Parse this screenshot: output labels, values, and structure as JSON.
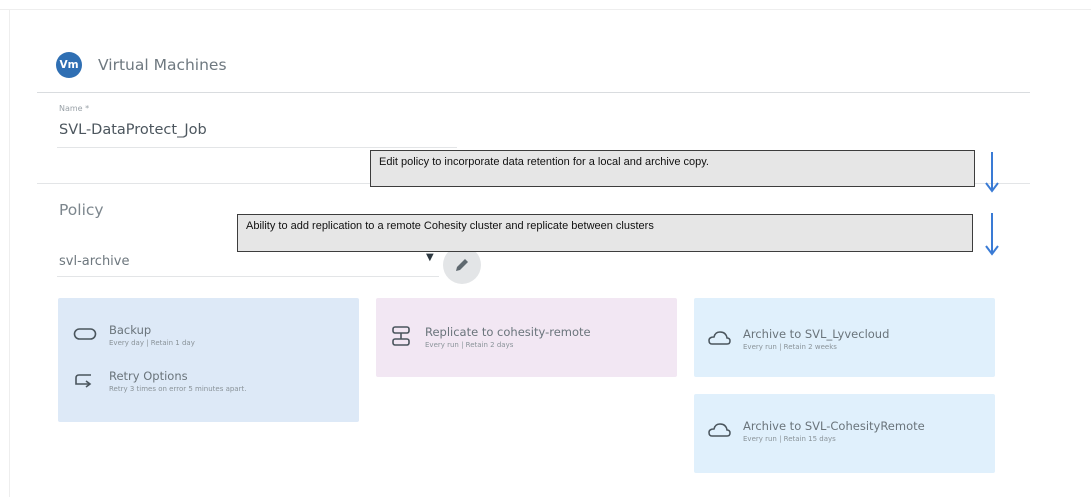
{
  "header": {
    "avatar_text": "Vm",
    "title": "Virtual Machines",
    "avatar_color": "#2f6fb3"
  },
  "name_field": {
    "label": "Name *",
    "value": "SVL-DataProtect_Job"
  },
  "policy": {
    "label": "Policy",
    "selected": "svl-archive"
  },
  "callouts": [
    "Edit policy to incorporate data retention for a local and archive copy.",
    "Ability to add replication to a remote Cohesity cluster and replicate between clusters"
  ],
  "cards": {
    "backup": {
      "title": "Backup",
      "detail": "Every day  |  Retain 1 day",
      "retry_title": "Retry Options",
      "retry_detail": "Retry 3 times on error 5 minutes apart."
    },
    "replicate": {
      "title": "Replicate to cohesity-remote",
      "detail": "Every run  |  Retain 2 days"
    },
    "archive1": {
      "title": "Archive to SVL_Lyvecloud",
      "detail": "Every run  |  Retain 2 weeks"
    },
    "archive2": {
      "title": "Archive to SVL-CohesityRemote",
      "detail": "Every run  |  Retain 15 days"
    }
  },
  "colors": {
    "backup_card": "#dde9f7",
    "replicate_card": "#f2e7f3",
    "archive_card": "#e0f0fc",
    "arrow": "#3a7bd5"
  },
  "icons": [
    "backup-icon",
    "retry-icon",
    "replicate-icon",
    "cloud-icon",
    "pencil-icon",
    "caret-down-icon",
    "arrow-down-icon"
  ]
}
